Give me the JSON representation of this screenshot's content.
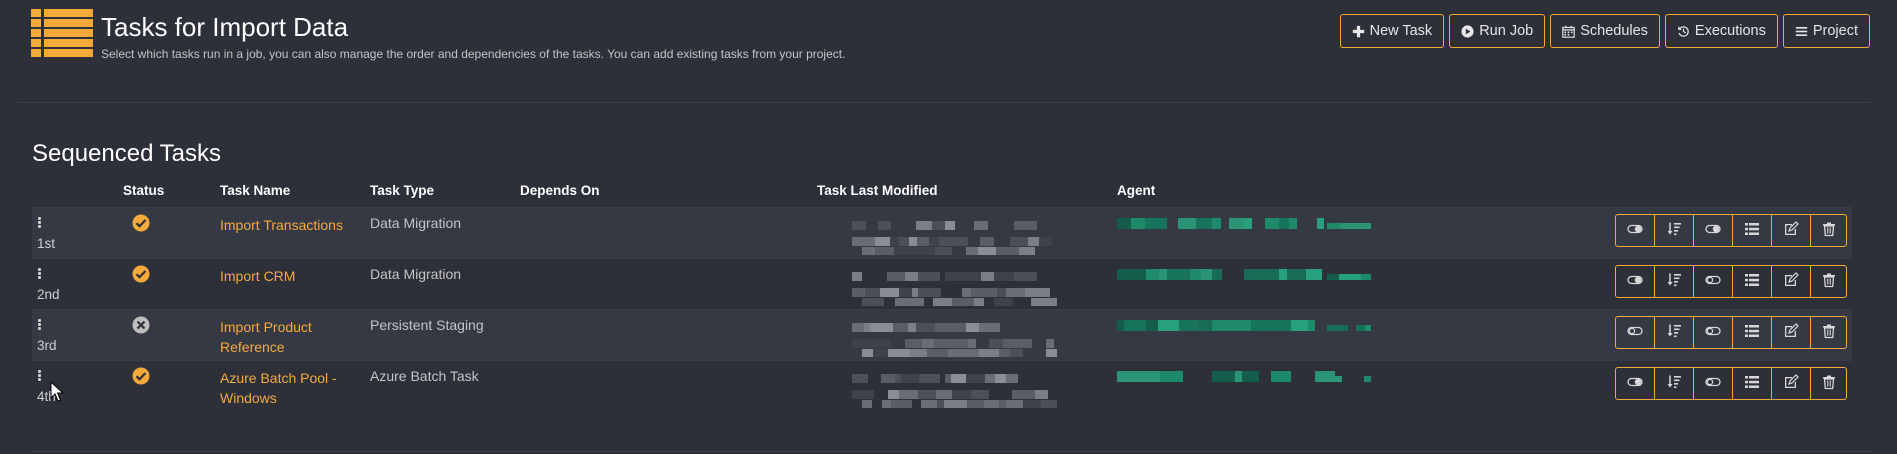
{
  "header": {
    "title": "Tasks for Import Data",
    "subtitle": "Select which tasks run in a job, you can also manage the order and dependencies of the tasks. You can add existing tasks from your project.",
    "icon": "list-icon",
    "accent": "#f6a93b"
  },
  "toolbar": {
    "new_task": "New Task",
    "run_job": "Run Job",
    "schedules": "Schedules",
    "executions": "Executions",
    "project": "Project"
  },
  "section_title": "Sequenced Tasks",
  "columns": {
    "status": "Status",
    "task_name": "Task Name",
    "task_type": "Task Type",
    "depends_on": "Depends On",
    "last_modified": "Task Last Modified",
    "agent": "Agent"
  },
  "tasks": [
    {
      "order": "1st",
      "status": "success",
      "name": "Import Transactions",
      "type": "Data Migration",
      "toggle1": "on",
      "toggle2": "on"
    },
    {
      "order": "2nd",
      "status": "success",
      "name": "Import CRM",
      "type": "Data Migration",
      "toggle1": "on",
      "toggle2": "off"
    },
    {
      "order": "3rd",
      "status": "disabled",
      "name": "Import Product Reference",
      "type": "Persistent Staging",
      "toggle1": "off",
      "toggle2": "off"
    },
    {
      "order": "4th",
      "status": "success",
      "name": "Azure Batch Pool - Windows",
      "type": "Azure Batch Task",
      "toggle1": "on",
      "toggle2": "off"
    }
  ],
  "colors": {
    "background": "#2d3039",
    "row_alt": "#353944",
    "success": "#f6a93b",
    "agent_blur": "#1f8a6a"
  }
}
